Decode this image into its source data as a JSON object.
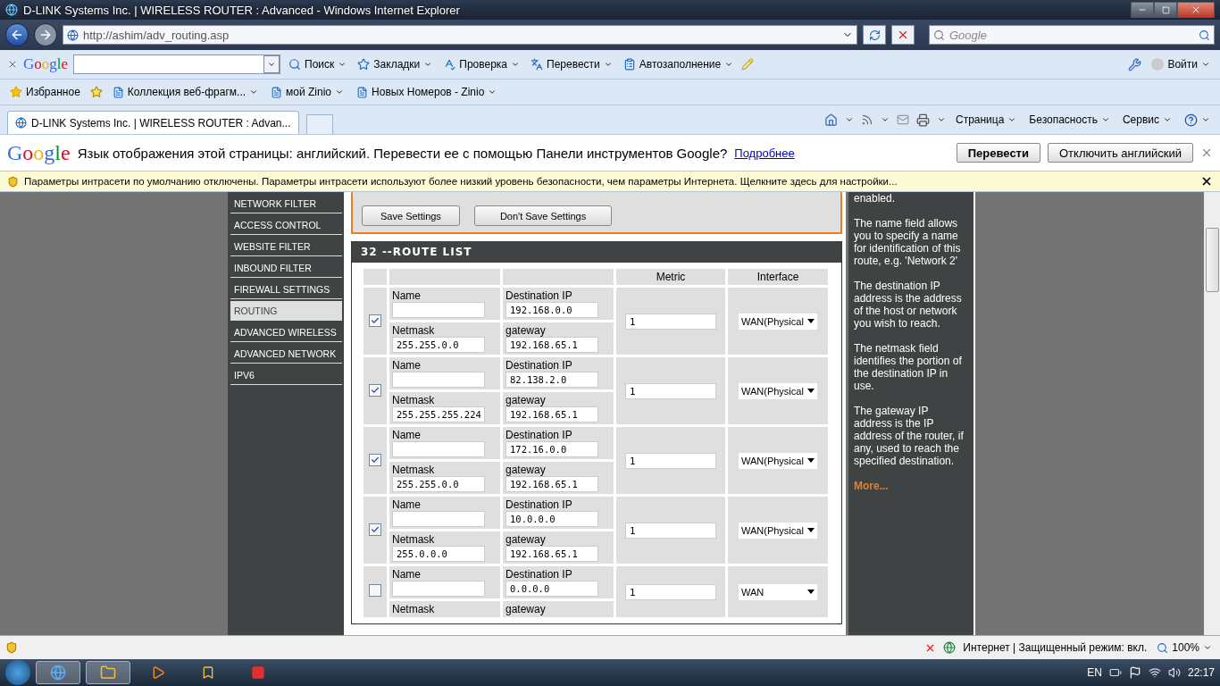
{
  "window": {
    "title": "D-LINK Systems Inc. | WIRELESS ROUTER : Advanced - Windows Internet Explorer"
  },
  "address_bar": {
    "url": "http://ashim/adv_routing.asp"
  },
  "search_field": {
    "placeholder": "Google"
  },
  "google_toolbar": {
    "logo": "Google",
    "items": [
      {
        "kind": "search",
        "label": "Поиск"
      },
      {
        "kind": "bookmarks",
        "label": "Закладки"
      },
      {
        "kind": "spellcheck",
        "label": "Проверка"
      },
      {
        "kind": "translate",
        "label": "Перевести"
      },
      {
        "kind": "autofill",
        "label": "Автозаполнение"
      }
    ],
    "sign_in": "Войти"
  },
  "favorites_bar": {
    "favorites": "Избранное",
    "links": [
      "Коллекция веб-фрагм...",
      "мой Zinio",
      "Новых Номеров - Zinio"
    ]
  },
  "tabs": [
    {
      "label": "D-LINK Systems Inc. | WIRELESS ROUTER : Advan...",
      "selected": true
    }
  ],
  "command_bar": [
    "Страница",
    "Безопасность",
    "Сервис"
  ],
  "translate_bar": {
    "logo": "Google",
    "message": "Язык отображения этой страницы: английский. Перевести ее с помощью Панели инструментов Google?",
    "link": "Подробнее",
    "buttons": [
      "Перевести",
      "Отключить английский"
    ]
  },
  "info_bar": {
    "message": "Параметры интрасети по умолчанию отключены. Параметры интрасети используют более низкий уровень безопасности, чем параметры Интернета. Щелкните здесь для настройки..."
  },
  "sidebar": {
    "items": [
      {
        "label": "NETWORK FILTER",
        "selected": false
      },
      {
        "label": "ACCESS CONTROL",
        "selected": false
      },
      {
        "label": "WEBSITE FILTER",
        "selected": false
      },
      {
        "label": "INBOUND FILTER",
        "selected": false
      },
      {
        "label": "FIREWALL SETTINGS",
        "selected": false
      },
      {
        "label": "ROUTING",
        "selected": true
      },
      {
        "label": "ADVANCED WIRELESS",
        "selected": false
      },
      {
        "label": "ADVANCED NETWORK",
        "selected": false
      },
      {
        "label": "IPV6",
        "selected": false
      }
    ]
  },
  "actions": [
    "Save Settings",
    "Don't Save Settings"
  ],
  "route_list": {
    "title": "32 --ROUTE LIST",
    "columns": [
      "Metric",
      "Interface"
    ],
    "rows": [
      {
        "enabled": true,
        "name_label": "Name",
        "dest_label": "Destination IP",
        "destination": "192.168.0.0",
        "netmask_label": "Netmask",
        "netmask": "255.255.0.0",
        "gateway_label": "gateway",
        "gateway": "192.168.65.1",
        "metric": "1",
        "interface": "WAN(Physical"
      },
      {
        "enabled": true,
        "name_label": "Name",
        "dest_label": "Destination IP",
        "destination": "82.138.2.0",
        "netmask_label": "Netmask",
        "netmask": "255.255.255.224",
        "gateway_label": "gateway",
        "gateway": "192.168.65.1",
        "metric": "1",
        "interface": "WAN(Physical"
      },
      {
        "enabled": true,
        "name_label": "Name",
        "dest_label": "Destination IP",
        "destination": "172.16.0.0",
        "netmask_label": "Netmask",
        "netmask": "255.255.0.0",
        "gateway_label": "gateway",
        "gateway": "192.168.65.1",
        "metric": "1",
        "interface": "WAN(Physical"
      },
      {
        "enabled": true,
        "name_label": "Name",
        "dest_label": "Destination IP",
        "destination": "10.0.0.0",
        "netmask_label": "Netmask",
        "netmask": "255.0.0.0",
        "gateway_label": "gateway",
        "gateway": "192.168.65.1",
        "metric": "1",
        "interface": "WAN(Physical"
      },
      {
        "enabled": false,
        "name_label": "Name",
        "dest_label": "Destination IP",
        "destination": "0.0.0.0",
        "netmask_label": "Netmask",
        "gateway_label": "gateway",
        "metric": "1",
        "interface": "WAN"
      }
    ]
  },
  "help": {
    "paragraphs": [
      "enabled.",
      "The name field allows you to specify a name for identification of this route, e.g. 'Network 2'",
      "The destination IP address is the address of the host or network you wish to reach.",
      "The netmask field identifies the portion of the destination IP in use.",
      "The gateway IP address is the IP address of the router, if any, used to reach the specified destination."
    ],
    "more": "More..."
  },
  "status_bar": {
    "zone": "Интернет | Защищенный режим: вкл.",
    "zoom": "100%"
  },
  "taskbar": {
    "language": "EN",
    "clock": "22:17"
  }
}
